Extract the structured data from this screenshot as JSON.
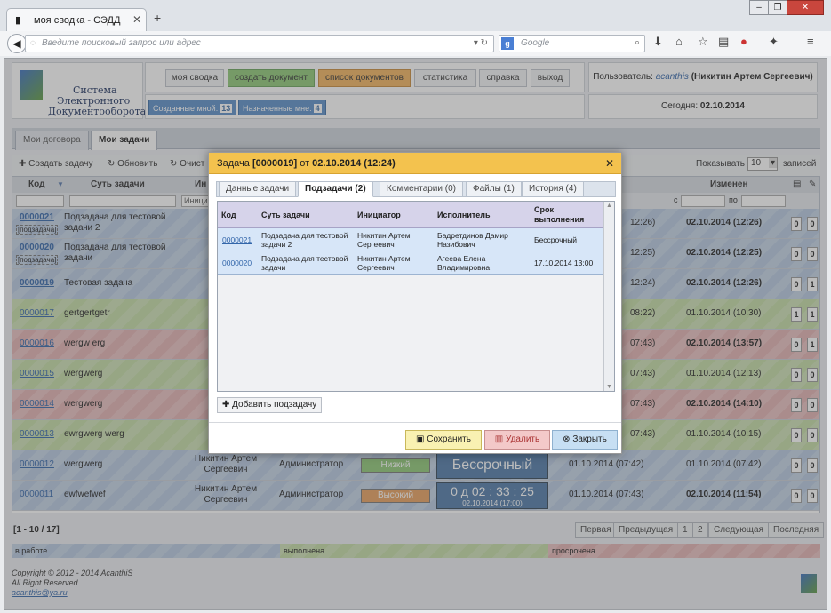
{
  "browser": {
    "tab_title": "моя сводка - СЭДД",
    "url_placeholder": "Введите поисковый запрос или адрес",
    "search_placeholder": "Google"
  },
  "app": {
    "logo_text": [
      "Система",
      "Электронного",
      "Документооборота"
    ],
    "menu": [
      "моя сводка",
      "создать документ",
      "список документов",
      "статистика",
      "справка",
      "выход"
    ],
    "counts": [
      {
        "label": "Созданные мной:",
        "value": "13"
      },
      {
        "label": "Назначенные мне:",
        "value": "4"
      }
    ],
    "user_label": "Пользователь:",
    "user_login": "acanthis",
    "user_name": "(Никитин Артем Сергеевич)",
    "today_label": "Сегодня:",
    "today": "02.10.2014"
  },
  "page_tabs": [
    "Мои договора",
    "Мои задачи"
  ],
  "toolbar": {
    "create": "Создать задачу",
    "refresh": "Обновить",
    "clear": "Очист",
    "show_label": "Показывать",
    "show_value": "10",
    "records": "записей"
  },
  "table": {
    "headers": {
      "code": "Код",
      "subject": "Суть задачи",
      "initiator": "Ин",
      "changed": "Изменен"
    },
    "filter_from": "с",
    "filter_to": "по",
    "filter_initiator": "Иници",
    "rows": [
      {
        "code": "0000021",
        "sub": "[подзадача]",
        "subject": "Подзадача для тестовой задачи 2",
        "mid": "12:26)",
        "changed": "02.10.2014 (12:26)",
        "c1": "0",
        "c2": "0",
        "color": "blue"
      },
      {
        "code": "0000020",
        "sub": "[подзадача]",
        "subject": "Подзадача для тестовой задачи",
        "mid": "12:25)",
        "changed": "02.10.2014 (12:25)",
        "c1": "0",
        "c2": "0",
        "color": "blue"
      },
      {
        "code": "0000019",
        "sub": "",
        "subject": "Тестовая задача",
        "mid": "12:24)",
        "changed": "02.10.2014 (12:26)",
        "c1": "0",
        "c2": "1",
        "color": "blue"
      },
      {
        "code": "0000017",
        "sub": "",
        "subject": "gertgertgetr",
        "mid": "08:22)",
        "changed": "01.10.2014 (10:30)",
        "c1": "1",
        "c2": "1",
        "color": "green"
      },
      {
        "code": "0000016",
        "sub": "",
        "subject": "wergw erg",
        "mid": "07:43)",
        "changed": "02.10.2014 (13:57)",
        "c1": "0",
        "c2": "1",
        "color": "red"
      },
      {
        "code": "0000015",
        "sub": "",
        "subject": "wergwerg",
        "mid": "07:43)",
        "changed": "01.10.2014 (12:13)",
        "c1": "0",
        "c2": "0",
        "color": "green"
      },
      {
        "code": "0000014",
        "sub": "",
        "subject": "wergwerg",
        "mid": "07:43)",
        "changed": "02.10.2014 (14:10)",
        "c1": "0",
        "c2": "0",
        "color": "red"
      },
      {
        "code": "0000013",
        "sub": "",
        "subject": "ewrgwerg werg",
        "mid": "07:43)",
        "changed": "01.10.2014 (10:15)",
        "c1": "0",
        "c2": "0",
        "color": "green"
      },
      {
        "code": "0000012",
        "sub": "",
        "subject": "wergwerg",
        "initiator": "Никитин Артем Сергеевич",
        "executor": "Администратор",
        "priority": "Низкий",
        "deadline": "Бессрочный",
        "created": "01.10.2014 (07:42)",
        "changed": "01.10.2014 (07:42)",
        "c1": "0",
        "c2": "0",
        "color": "blue"
      },
      {
        "code": "0000011",
        "sub": "",
        "subject": "ewfwefwef",
        "initiator": "Никитин Артем Сергеевич",
        "executor": "Администратор",
        "priority": "Высокий",
        "deadline": "0 д  02 : 33 : 25",
        "deadline_date": "02.10.2014 (17:00)",
        "created": "01.10.2014 (07:43)",
        "changed": "02.10.2014 (11:54)",
        "c1": "0",
        "c2": "0",
        "color": "blue"
      }
    ]
  },
  "pager": {
    "range": "[1 - 10 / 17]",
    "buttons": [
      "Первая",
      "Предыдущая",
      "1",
      "2",
      "Следующая",
      "Последняя"
    ]
  },
  "legend": [
    "в работе",
    "выполнена",
    "просрочена"
  ],
  "footer": [
    "Copyright © 2012 - 2014 AcanthiS",
    "All Right Reserved",
    "acanthis@ya.ru"
  ],
  "modal": {
    "title_prefix": "Задача",
    "title_code": "[0000019]",
    "title_mid": "от",
    "title_date": "02.10.2014 (12:24)",
    "tabs": [
      "Данные задачи",
      "Подзадачи (2)",
      "Комментарии (0)",
      "Файлы (1)",
      "История (4)"
    ],
    "grid_headers": [
      "Код",
      "Суть задачи",
      "Инициатор",
      "Исполнитель",
      "Срок выполнения"
    ],
    "rows": [
      {
        "code": "0000021",
        "subject": "Подзадача для тестовой задачи 2",
        "initiator": "Никитин Артем Сергеевич",
        "executor": "Бадретдинов Дамир Назибович",
        "deadline": "Бессрочный"
      },
      {
        "code": "0000020",
        "subject": "Подзадача для тестовой задачи",
        "initiator": "Никитин Артем Сергеевич",
        "executor": "Агеева Елена Владимировна",
        "deadline": "17.10.2014 13:00"
      }
    ],
    "add_subtask": "Добавить подзадачу",
    "save": "Сохранить",
    "delete": "Удалить",
    "close": "Закрыть"
  },
  "colors": {
    "blue_row": "#b7c9e1",
    "green_row": "#c3dba5",
    "red_row": "#e3b2b2",
    "modal_header": "#f3c24e"
  }
}
